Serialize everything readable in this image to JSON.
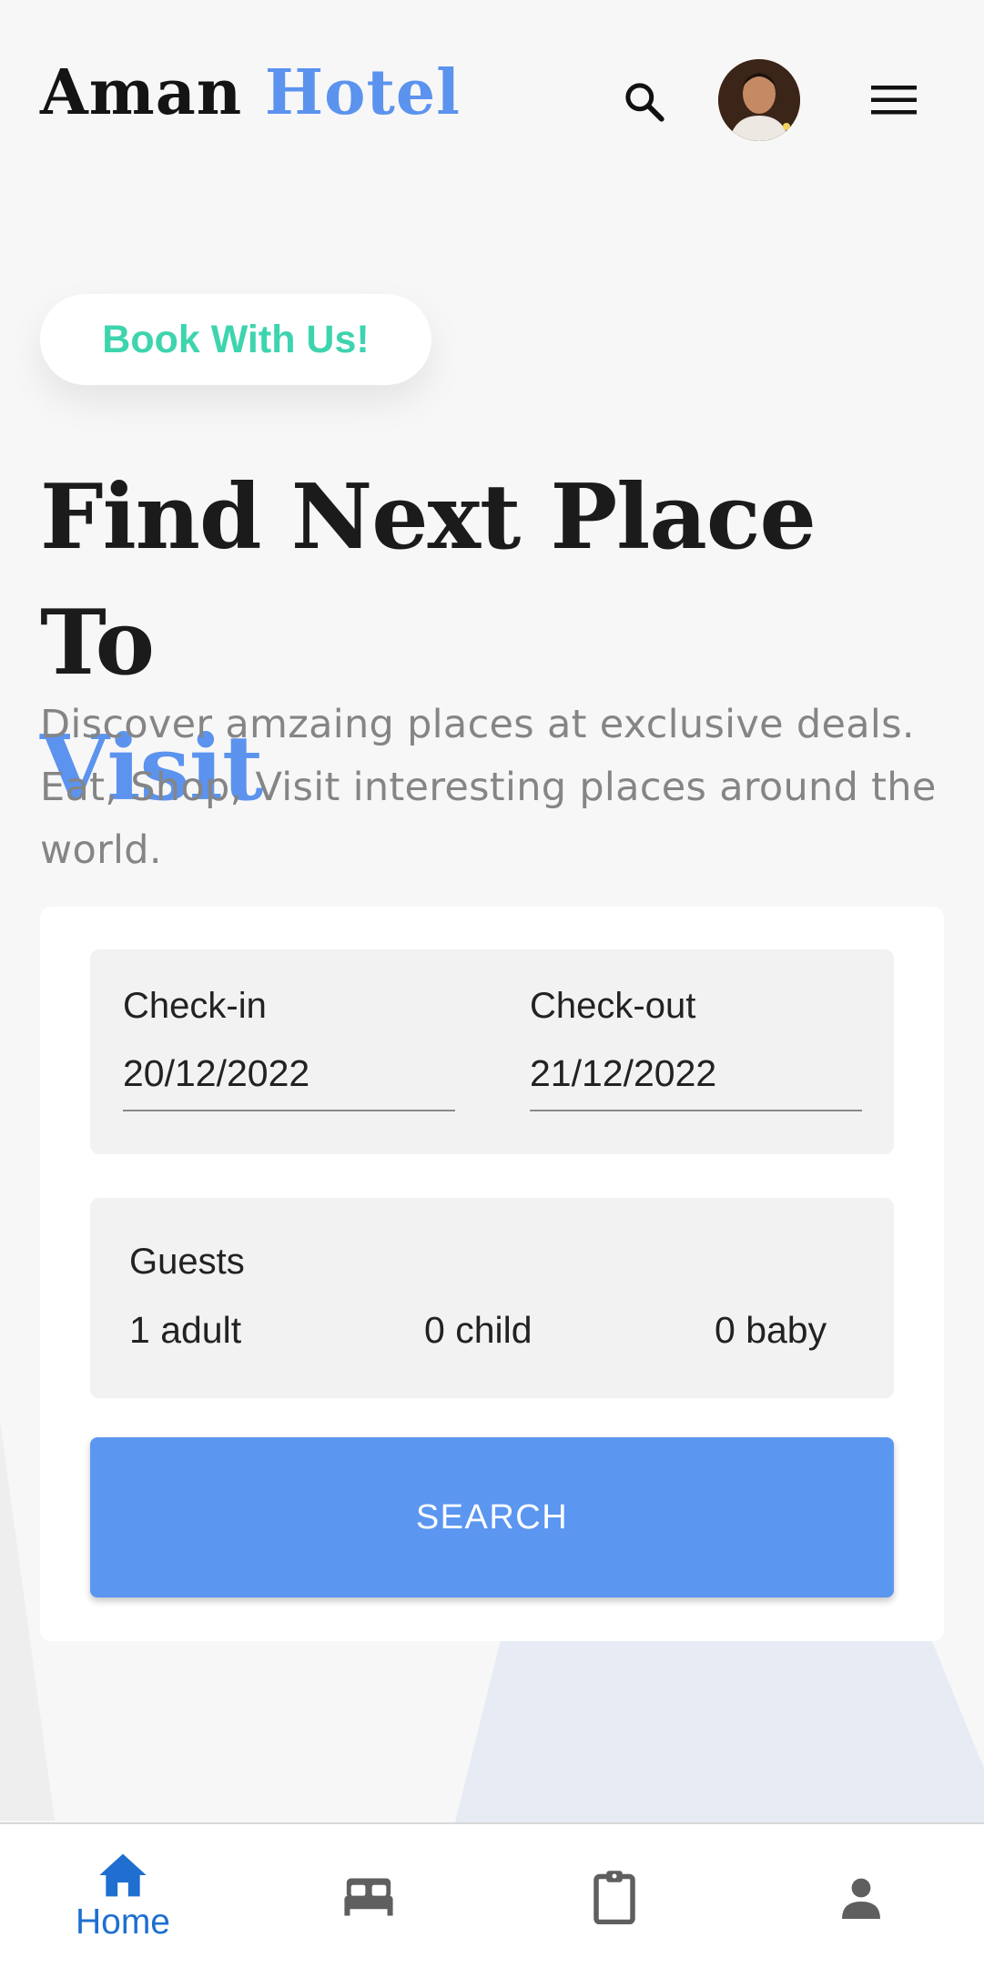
{
  "header": {
    "brand_first": "Aman",
    "brand_second": "Hotel",
    "search_icon": "search-icon",
    "menu_icon": "hamburger-menu-icon",
    "avatar": "user-avatar"
  },
  "hero": {
    "badge": "Book With Us!",
    "headline_line1": "Find Next Place To",
    "headline_accent": "Visit",
    "description": "Discover amzaing places at exclusive deals. Eat, Shop, Visit interesting places around the world."
  },
  "form": {
    "checkin_label": "Check-in",
    "checkin_value": "20/12/2022",
    "checkout_label": "Check-out",
    "checkout_value": "21/12/2022",
    "guests_label": "Guests",
    "adults": "1 adult",
    "children": "0 child",
    "babies": "0 baby",
    "search_label": "SEARCH"
  },
  "bottom_nav": {
    "items": [
      {
        "icon": "home-icon",
        "label": "Home",
        "active": true
      },
      {
        "icon": "bed-icon",
        "label": "",
        "active": false
      },
      {
        "icon": "clipboard-icon",
        "label": "",
        "active": false
      },
      {
        "icon": "person-icon",
        "label": "",
        "active": false
      }
    ]
  },
  "colors": {
    "accent_blue": "#5b93ee",
    "badge_green": "#3dd4ae",
    "button_blue": "#5b96f0",
    "nav_active": "#1e6fd0",
    "nav_inactive": "#5f5f5f",
    "background": "#f7f7f7"
  }
}
